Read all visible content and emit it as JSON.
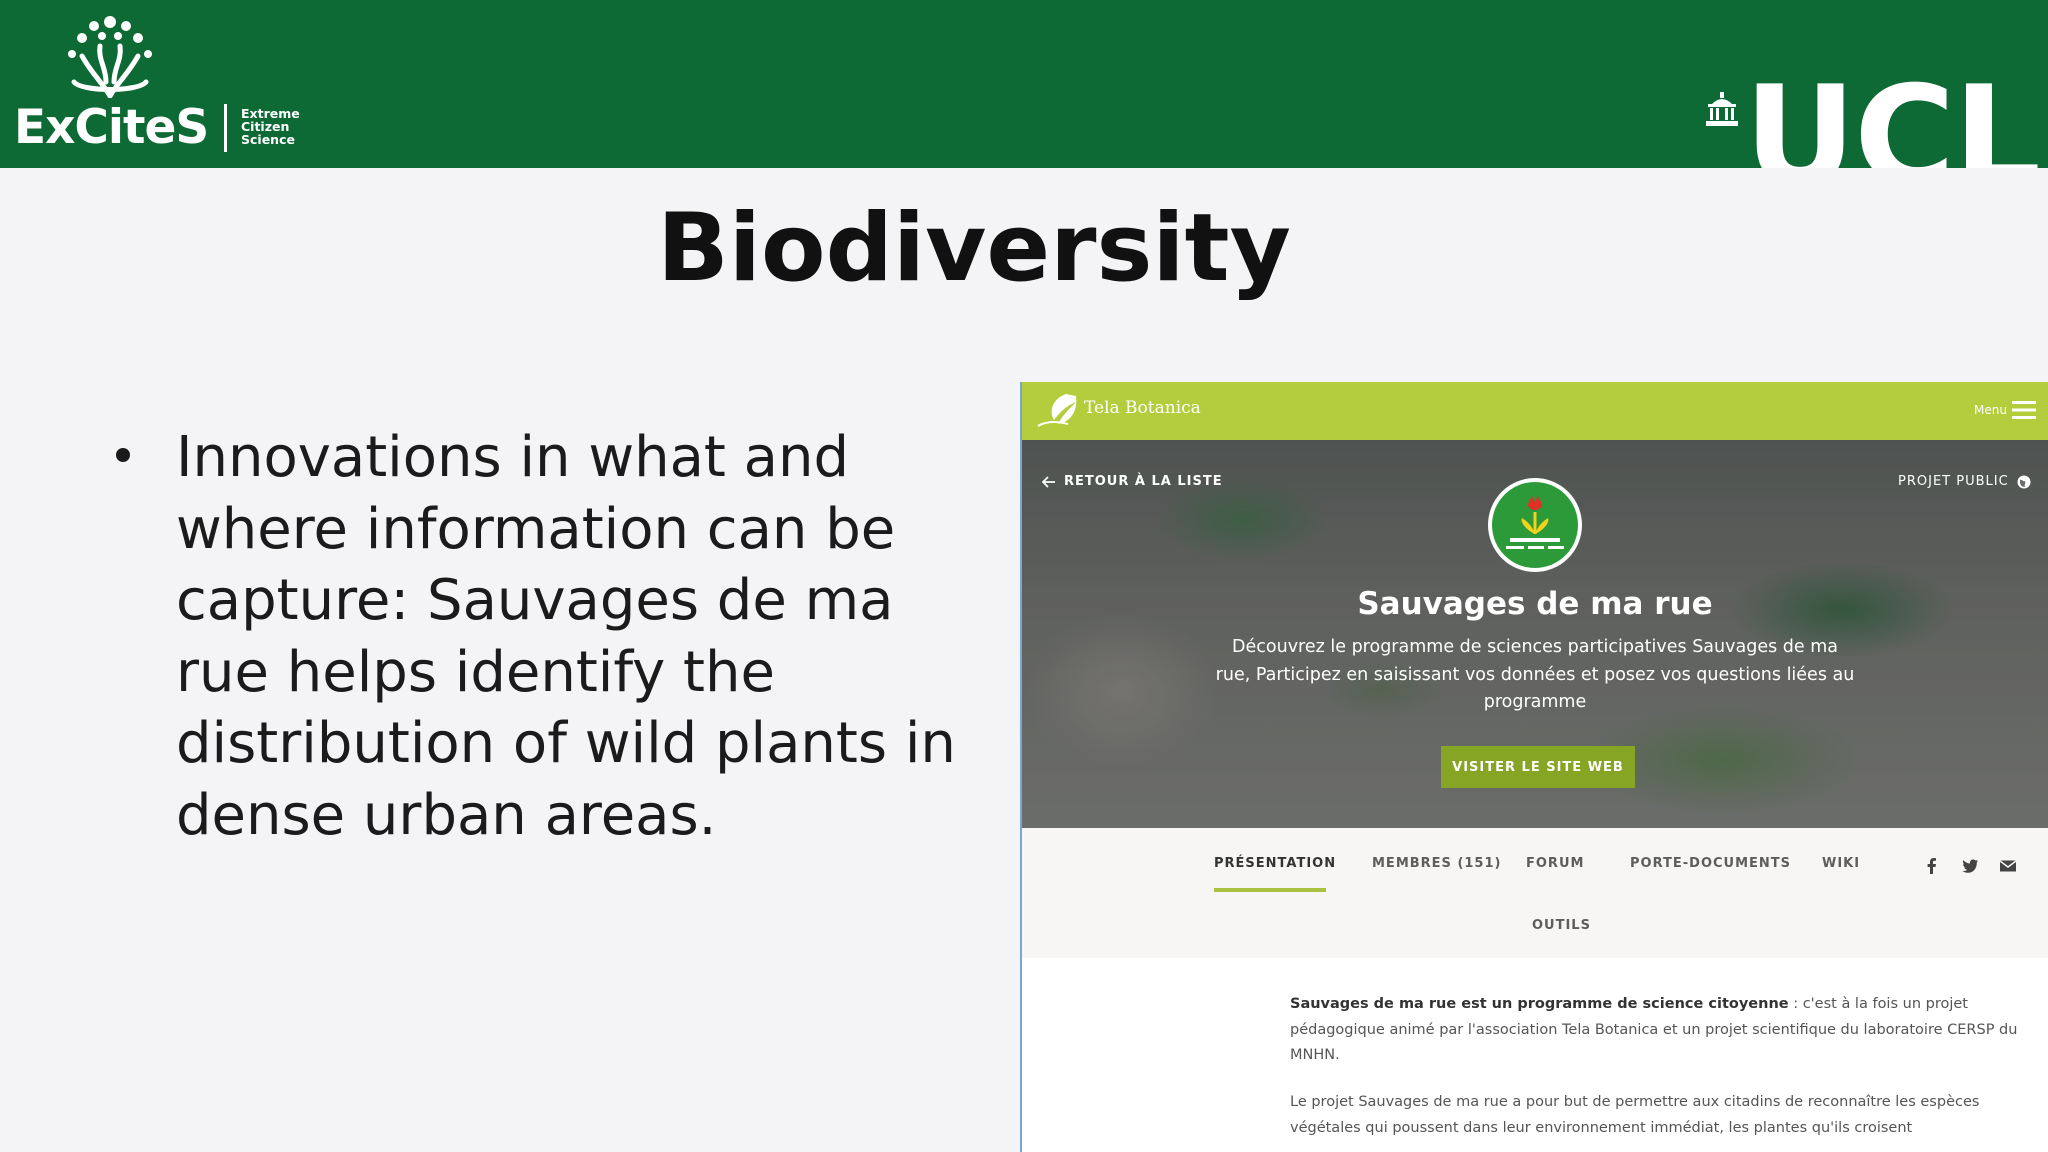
{
  "header": {
    "org_name": "ExCiteS",
    "org_tagline": [
      "Extreme",
      "Citizen",
      "Science"
    ],
    "university": "UCL",
    "background_color": "#0e6a35"
  },
  "slide": {
    "title": "Biodiversity",
    "bullet": "Innovations in what and where information can be capture: Sauvages de ma rue helps identify the distribution of wild plants in dense urban areas."
  },
  "website": {
    "site_name": "Tela Botanica",
    "menu_label": "Menu",
    "back_link": "RETOUR À LA LISTE",
    "visibility": "PROJET PUBLIC",
    "project_title": "Sauvages de ma rue",
    "project_description": "Découvrez le programme de sciences participatives Sauvages de ma rue, Participez en saisissant vos données et posez vos questions liées au programme",
    "visit_button": "VISITER LE SITE WEB",
    "tabs": [
      {
        "label": "PRÉSENTATION",
        "active": true
      },
      {
        "label": "MEMBRES (151)",
        "active": false
      },
      {
        "label": "FORUM",
        "active": false
      },
      {
        "label": "PORTE-DOCUMENTS",
        "active": false
      },
      {
        "label": "WIKI",
        "active": false
      },
      {
        "label": "OUTILS",
        "active": false
      }
    ],
    "share_icons": [
      "facebook-icon",
      "twitter-icon",
      "email-icon"
    ],
    "paragraph1_bold": "Sauvages de ma rue est un programme de science citoyenne",
    "paragraph1_rest": " : c'est à la fois un projet pédagogique animé par l'association Tela Botanica et un projet scientifique du laboratoire CERSP du MNHN.",
    "paragraph2": "Le projet Sauvages de ma rue a pour but de permettre aux citadins de reconnaître les espèces végétales qui poussent dans leur environnement immédiat, les plantes qu'ils croisent",
    "accent_color": "#b3cd3c"
  }
}
